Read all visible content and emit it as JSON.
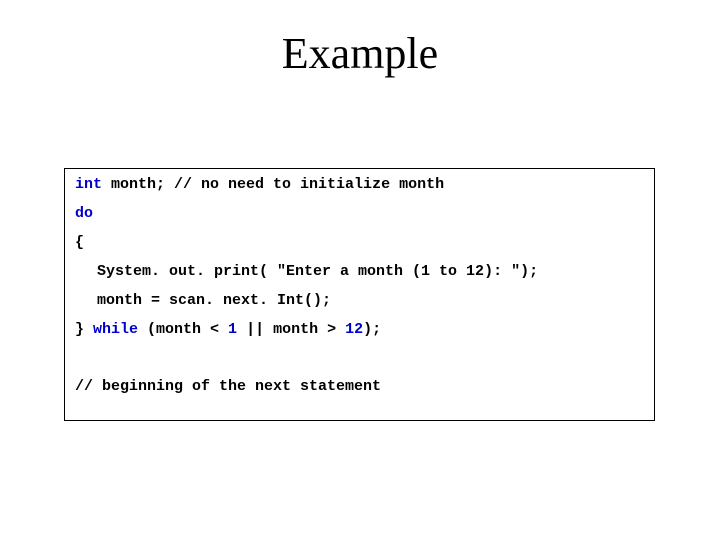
{
  "title": "Example",
  "code": {
    "l1_a": "int",
    "l1_b": " month; ",
    "l1_c": "// no need to initialize month",
    "l2": "do",
    "l3": "{",
    "l4": "System. out. print( \"Enter a month (1 to 12): \");",
    "l5": "month = scan. next. Int();",
    "l6_a": "} ",
    "l6_b": "while",
    "l6_c": " (month < ",
    "l6_d": "1",
    "l6_e": " || month > ",
    "l6_f": "12",
    "l6_g": ");",
    "l7": "// beginning of the next statement"
  }
}
